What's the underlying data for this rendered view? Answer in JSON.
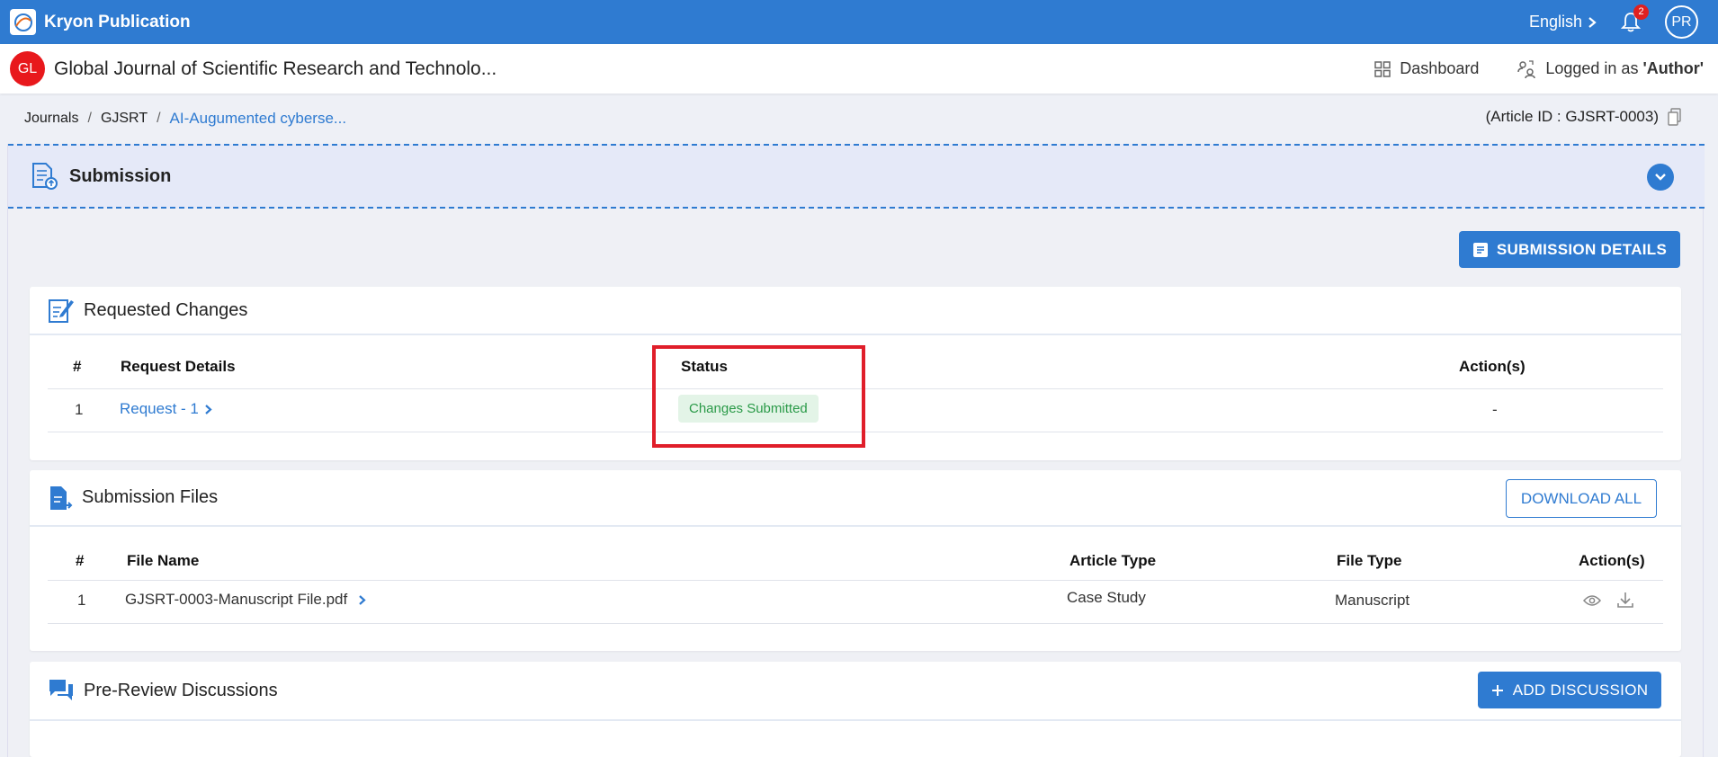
{
  "app": {
    "name": "Kryon Publication",
    "language": "English",
    "notifications": "2",
    "user_initials": "PR"
  },
  "journal": {
    "initials": "GL",
    "title": "Global Journal of Scientific Research and Technolo...",
    "dashboard": "Dashboard",
    "logged_in_prefix": "Logged in as ",
    "role": "'Author'"
  },
  "breadcrumb": {
    "items": [
      "Journals",
      "GJSRT"
    ],
    "current": "AI-Augumented cyberse...",
    "separator": "/"
  },
  "article_id": "(Article ID : GJSRT-0003)",
  "submission": {
    "title": "Submission",
    "details_button": "SUBMISSION DETAILS",
    "requested_changes": {
      "title": "Requested Changes",
      "headers": [
        "#",
        "Request Details",
        "Status",
        "Action(s)"
      ],
      "rows": [
        {
          "num": "1",
          "request": "Request - 1",
          "status": "Changes Submitted",
          "action": "-"
        }
      ]
    },
    "files": {
      "title": "Submission Files",
      "download_all": "DOWNLOAD ALL",
      "headers": [
        "#",
        "File Name",
        "Article Type",
        "File Type",
        "Action(s)"
      ],
      "rows": [
        {
          "num": "1",
          "file_name": "GJSRT-0003-Manuscript File.pdf",
          "article_type": "Case Study",
          "file_type": "Manuscript"
        }
      ]
    },
    "discussions": {
      "title": "Pre-Review Discussions",
      "add_button": "ADD DISCUSSION"
    }
  },
  "colors": {
    "primary": "#2f7bd1",
    "badge_bg": "#e3f4e7",
    "badge_text": "#2a9a48",
    "highlight": "#e01e2a"
  }
}
